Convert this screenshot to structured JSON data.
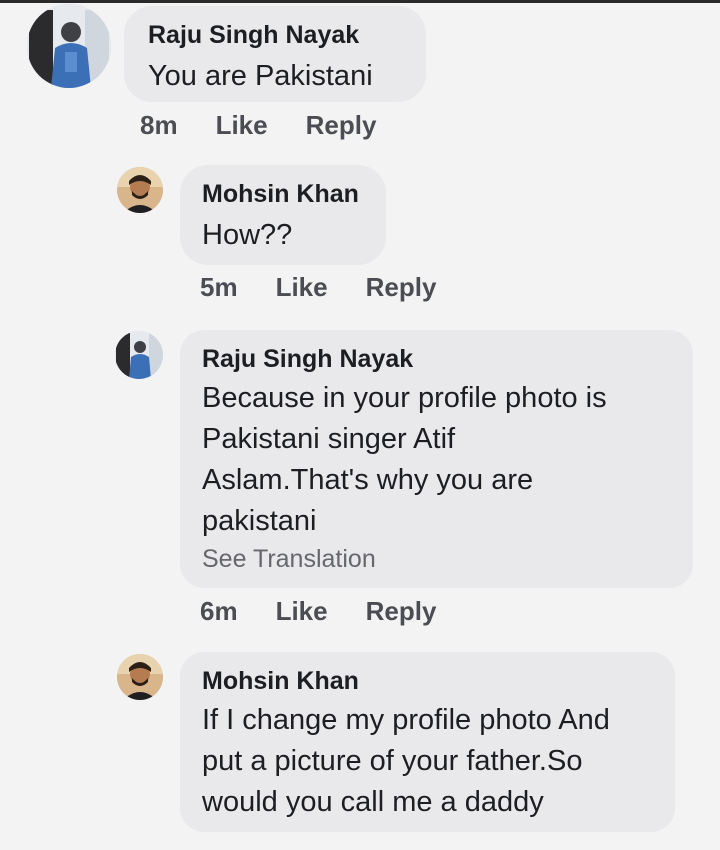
{
  "comments": [
    {
      "author": "Raju Singh Nayak",
      "lines": [
        "You are Pakistani"
      ],
      "time": "8m",
      "like_label": "Like",
      "reply_label": "Reply"
    },
    {
      "author": "Mohsin Khan",
      "lines": [
        "How??"
      ],
      "time": "5m",
      "like_label": "Like",
      "reply_label": "Reply"
    },
    {
      "author": "Raju Singh Nayak",
      "lines": [
        "Because in your profile photo is",
        "Pakistani singer Atif",
        "Aslam.That's why you are",
        "pakistani"
      ],
      "see_translation": "See Translation",
      "time": "6m",
      "like_label": "Like",
      "reply_label": "Reply"
    },
    {
      "author": "Mohsin Khan",
      "lines": [
        "If I change my profile photo And",
        "put a picture of your father.So",
        "would you call me a daddy"
      ]
    }
  ],
  "colors": {
    "page_background": "#f3f3f4",
    "bubble_background": "#e9e9ec",
    "text": "#1c1e21",
    "secondary_text": "#65676b"
  },
  "icons": {
    "avatar_raju": "profile-photo-person-in-blue",
    "avatar_mohsin": "profile-photo-man-with-beard"
  }
}
